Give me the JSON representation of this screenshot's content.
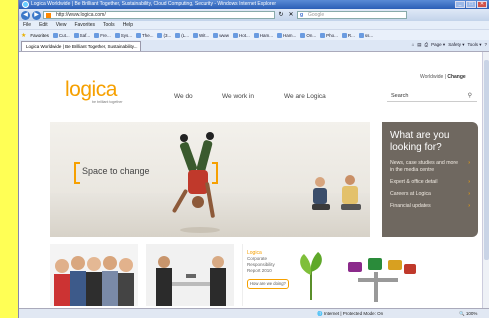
{
  "window": {
    "title": "Logica Worldwide | Be Brilliant Together, Sustainability, Cloud Computing, Security - Windows Internet Explorer",
    "minimize": "_",
    "maximize": "□",
    "close": "✕"
  },
  "address_bar": {
    "back": "◀",
    "forward": "▶",
    "url": "http://www.logica.com/",
    "refresh": "↻",
    "stop": "✕",
    "search_placeholder": "Google",
    "search_glyph": "g"
  },
  "menu": [
    "File",
    "Edit",
    "View",
    "Favorites",
    "Tools",
    "Help"
  ],
  "favorites_bar": {
    "label": "Favorites",
    "items": [
      "Cut...",
      "Saf...",
      "Fre...",
      "Sys...",
      "The...",
      "(3...",
      "(L...",
      "Wit...",
      "www",
      "Hot...",
      "Ham...",
      "Ham...",
      "On...",
      "Pho...",
      "R...",
      "ss..."
    ]
  },
  "tab": {
    "label": "Logica Worldwide | Be Brilliant Together, Sustainability..."
  },
  "tab_tools": [
    "Page ▾",
    "Safety ▾",
    "Tools ▾"
  ],
  "site": {
    "top_links": {
      "worldwide": "Worldwide",
      "sep": "|",
      "change": "Change"
    },
    "logo": "logica",
    "tagline": "be brilliant together",
    "nav": [
      "We do",
      "We work in",
      "We are Logica"
    ],
    "search_label": "Search",
    "search_icon": "🔍",
    "hero_text": "Space to change",
    "panel": {
      "title": "What are you looking for?",
      "links": [
        "News, case studies and more in the media centre",
        "Expert & office detail",
        "Careers at Logica",
        "Financial updates"
      ],
      "arrow": "›"
    },
    "report": {
      "line1": "Logica",
      "line2": "Corporate",
      "line3": "Responsibility",
      "line4": "Report 2010",
      "button": "How are we doing?"
    }
  },
  "status_bar": {
    "mode": "Internet | Protected Mode: On",
    "zoom": "100%"
  },
  "colors": {
    "brand": "#f6a000",
    "panel": "#6f6860"
  }
}
